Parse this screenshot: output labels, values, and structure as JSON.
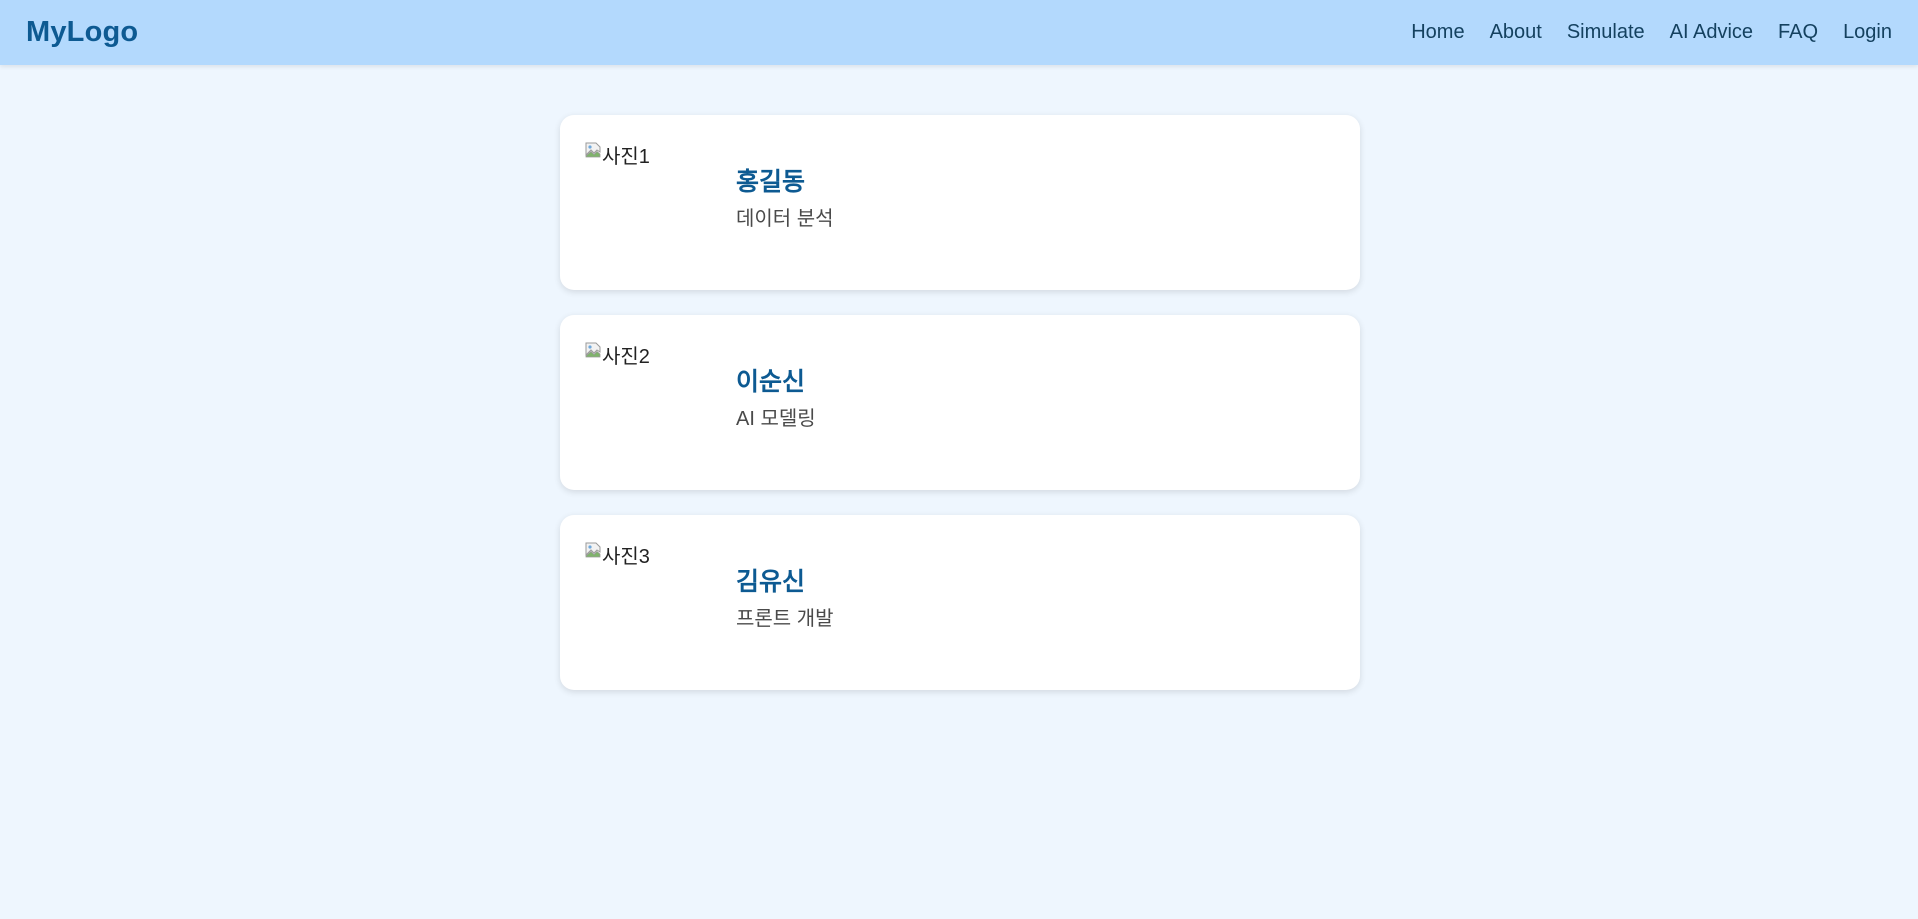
{
  "navbar": {
    "logo": "MyLogo",
    "links": [
      {
        "label": "Home"
      },
      {
        "label": "About"
      },
      {
        "label": "Simulate"
      },
      {
        "label": "AI Advice"
      },
      {
        "label": "FAQ"
      },
      {
        "label": "Login"
      }
    ]
  },
  "members": [
    {
      "photo_alt": "사진1",
      "name": "홍길동",
      "role": "데이터 분석"
    },
    {
      "photo_alt": "사진2",
      "name": "이순신",
      "role": "AI 모델링"
    },
    {
      "photo_alt": "사진3",
      "name": "김유신",
      "role": "프론트 개발"
    }
  ],
  "colors": {
    "page_bg": "#eef6fe",
    "navbar_bg": "#b3d9fd",
    "brand": "#0d5a92",
    "nav_text": "#14415f",
    "card_bg": "#ffffff"
  },
  "icons": {
    "broken_image": "broken-image-icon"
  }
}
